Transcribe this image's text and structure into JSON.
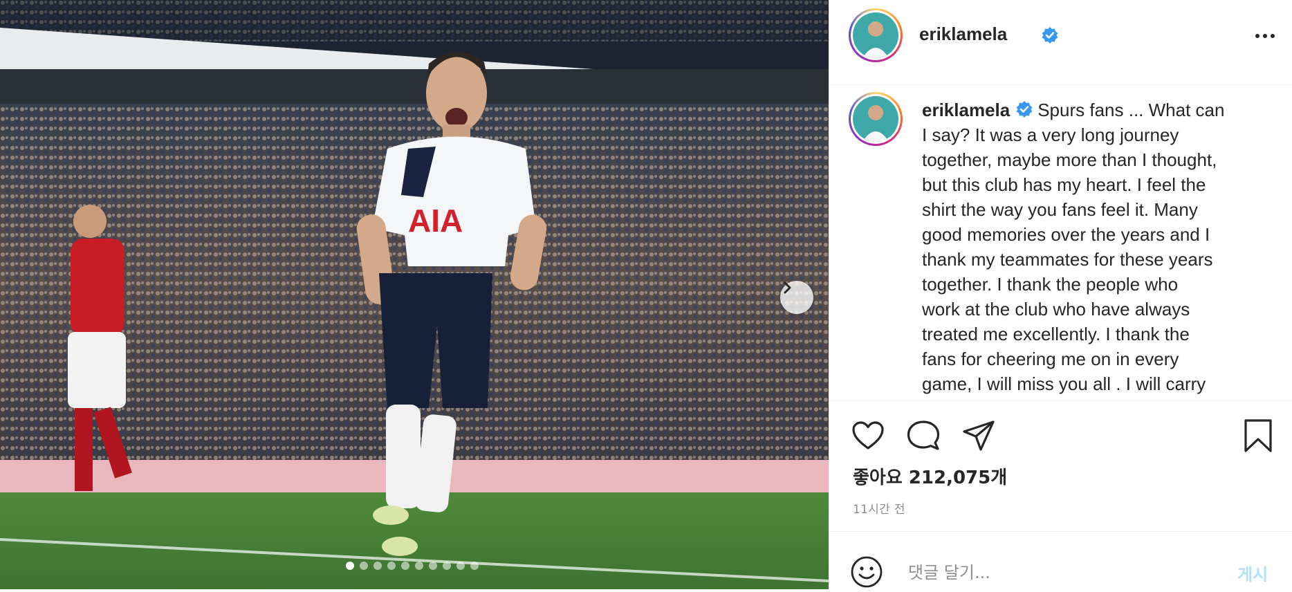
{
  "post": {
    "username": "eriklamela",
    "verified": true,
    "caption_lines": [
      "Spurs fans ... What can",
      "I say? It was a very long journey",
      "together, maybe more than I thought,",
      "but this club has my heart. I feel the",
      "shirt the way you fans feel it. Many",
      "good memories over the years and I",
      "thank my teammates for these years",
      "together. I thank the people who",
      "work at the club who have always",
      "treated me excellently. I thank the",
      "fans for cheering me on in every",
      "game, I will miss you all . I will carry"
    ],
    "likes_text": "좋아요 212,075개",
    "time_text": "11시간 전",
    "carousel": {
      "total_slides": 10,
      "active_index": 0
    }
  },
  "comment": {
    "placeholder": "댓글 달기...",
    "post_label": "게시"
  },
  "icons": {
    "more": "more-options-icon",
    "like": "heart-icon",
    "comment": "comment-icon",
    "share": "send-icon",
    "save": "bookmark-icon",
    "emoji": "emoji-icon",
    "next": "chevron-right-icon",
    "verified": "verified-badge-icon"
  },
  "colors": {
    "verified": "#3897f0",
    "post_button": "#b2dffc",
    "secondary_text": "#8e8e8e"
  }
}
